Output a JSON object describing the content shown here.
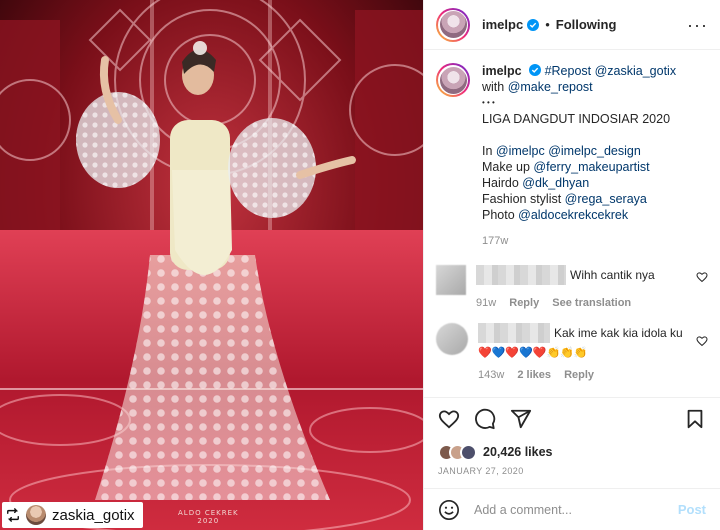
{
  "post_media": {
    "repost_username": "zaskia_gotix",
    "watermark_line1": "ALDO CEKREK",
    "watermark_line2": "2020"
  },
  "header": {
    "username": "imelpc",
    "separator": "•",
    "follow_status": "Following",
    "more_label": "···"
  },
  "caption": {
    "username": "imelpc",
    "repost_mention": "#Repost @zaskia_gotix",
    "with_prefix": "with ",
    "with_mention": "@make_repost",
    "dots": "• • •",
    "title": "LIGA DANGDUT INDOSIAR 2020",
    "lines": [
      {
        "label": "In ",
        "mentions": "@imelpc @imelpc_design"
      },
      {
        "label": "Make up ",
        "mentions": "@ferry_makeupartist"
      },
      {
        "label": "Hairdo ",
        "mentions": "@dk_dhyan"
      },
      {
        "label": "Fashion stylist ",
        "mentions": "@rega_seraya"
      },
      {
        "label": "Photo ",
        "mentions": "@aldocekrekcekrek"
      }
    ],
    "age": "177w"
  },
  "comments": [
    {
      "text": "Wihh cantik nya",
      "emojis": "",
      "age": "91w",
      "likes": "",
      "reply": "Reply",
      "extra": "See translation"
    },
    {
      "text": "Kak ime kak kia idola ku",
      "emojis": "❤️💙❤️💙❤️👏👏👏",
      "age": "143w",
      "likes": "2 likes",
      "reply": "Reply",
      "extra": ""
    }
  ],
  "actions": {
    "likes_count": "20,426 likes",
    "date": "JANUARY 27, 2020"
  },
  "add_comment": {
    "placeholder": "Add a comment...",
    "post_label": "Post"
  },
  "colors": {
    "link": "#00376b",
    "verified": "#0095f6",
    "heart_red": "#ed4956",
    "heart_blue": "#3897f0",
    "post_disabled": "#b2dffc"
  }
}
